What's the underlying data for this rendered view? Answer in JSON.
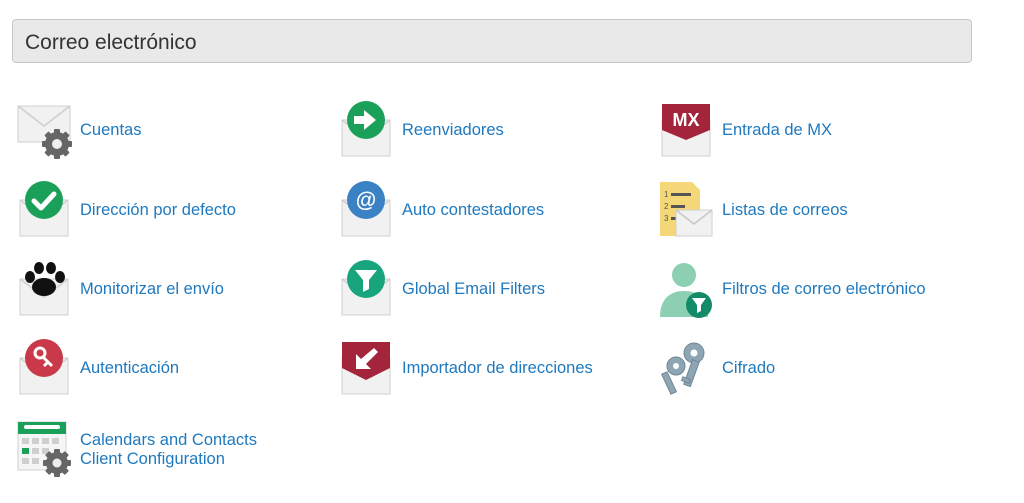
{
  "section": {
    "title": "Correo electrónico"
  },
  "items": [
    {
      "label": "Cuentas",
      "icon": "email-accounts-gear-icon"
    },
    {
      "label": "Reenviadores",
      "icon": "forwarders-arrow-icon"
    },
    {
      "label": "Entrada de MX",
      "icon": "mx-entry-icon",
      "icon_text": "MX"
    },
    {
      "label": "Dirección por defecto",
      "icon": "default-address-check-icon"
    },
    {
      "label": "Auto contestadores",
      "icon": "autoresponder-at-icon"
    },
    {
      "label": "Listas de correos",
      "icon": "mailing-lists-icon",
      "icon_text": [
        "1",
        "2",
        "3"
      ]
    },
    {
      "label": "Monitorizar el envío",
      "icon": "track-delivery-paw-icon"
    },
    {
      "label": "Global Email Filters",
      "icon": "global-filter-funnel-icon"
    },
    {
      "label": "Filtros de correo electrónico",
      "icon": "user-filter-funnel-icon"
    },
    {
      "label": "Autenticación",
      "icon": "authentication-key-icon"
    },
    {
      "label": "Importador de direcciones",
      "icon": "address-importer-icon"
    },
    {
      "label": "Cifrado",
      "icon": "encryption-keys-icon"
    },
    {
      "label_lines": [
        "Calendars and Contacts",
        "Client Configuration"
      ],
      "icon": "calendar-gear-icon"
    }
  ],
  "colors": {
    "link": "#1e79bf",
    "green": "#1ba05a",
    "teal": "#18a57e",
    "blue": "#3b82c4",
    "red": "#c9394a",
    "maroon": "#a3243b",
    "envelope": "#efefef",
    "header_bg": "#e9e9e9"
  }
}
